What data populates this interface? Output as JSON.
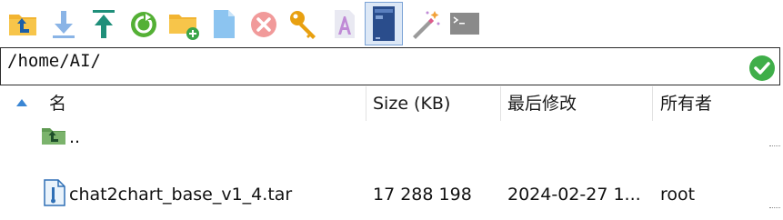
{
  "toolbar": {
    "buttons": [
      {
        "name": "parent-folder-button",
        "icon": "folder-up-icon"
      },
      {
        "name": "download-button",
        "icon": "download-arrow-icon"
      },
      {
        "name": "upload-button",
        "icon": "upload-arrow-icon"
      },
      {
        "name": "refresh-button",
        "icon": "refresh-icon"
      },
      {
        "name": "new-folder-button",
        "icon": "new-folder-icon"
      },
      {
        "name": "new-file-button",
        "icon": "new-file-icon"
      },
      {
        "name": "delete-button",
        "icon": "delete-x-icon"
      },
      {
        "name": "permissions-button",
        "icon": "key-icon"
      },
      {
        "name": "rename-button",
        "icon": "rename-a-icon"
      },
      {
        "name": "split-view-button",
        "icon": "panel-icon"
      },
      {
        "name": "magic-wand-button",
        "icon": "magic-wand-icon"
      },
      {
        "name": "terminal-button",
        "icon": "terminal-icon"
      }
    ]
  },
  "path": {
    "value": "/home/AI/"
  },
  "columns": {
    "name": "名",
    "size": "Size (KB)",
    "modified": "最后修改",
    "owner": "所有者"
  },
  "rows": [
    {
      "name": "..",
      "size": "",
      "modified": "",
      "owner": "",
      "icon": "parent-folder-icon"
    },
    {
      "name": "chat2chart_base_v1_4.tar",
      "size": "17 288 198",
      "modified": "2024-02-27 1...",
      "owner": "root",
      "icon": "file-icon"
    }
  ],
  "colors": {
    "accent": "#2b7fd6",
    "ok_green": "#3fae49"
  }
}
